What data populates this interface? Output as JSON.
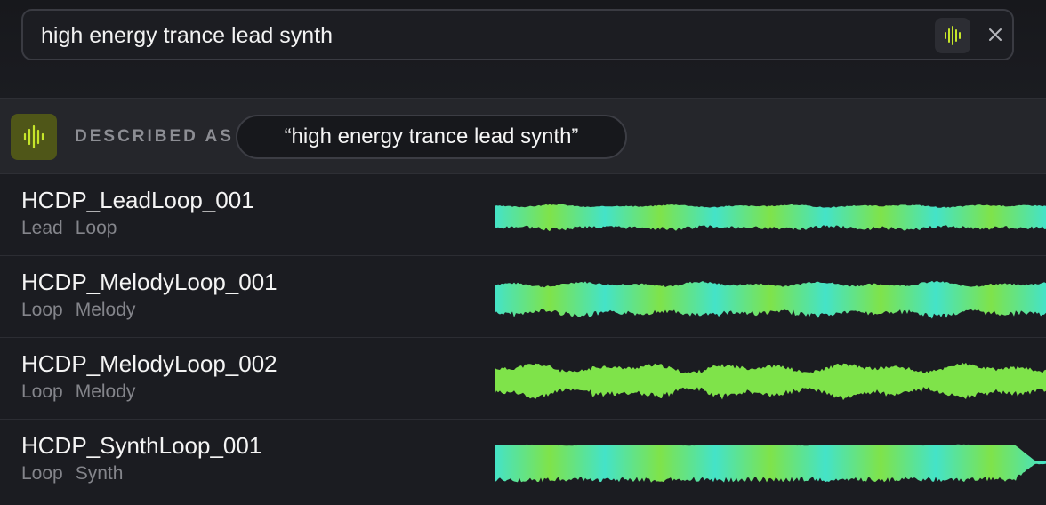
{
  "search": {
    "value": "high energy trance lead synth"
  },
  "description": {
    "label": "DESCRIBED AS",
    "query": "“high energy trance lead synth”"
  },
  "results": [
    {
      "name": "HCDP_LeadLoop_001",
      "tags": [
        "Lead",
        "Loop"
      ]
    },
    {
      "name": "HCDP_MelodyLoop_001",
      "tags": [
        "Loop",
        "Melody"
      ]
    },
    {
      "name": "HCDP_MelodyLoop_002",
      "tags": [
        "Loop",
        "Melody"
      ]
    },
    {
      "name": "HCDP_SynthLoop_001",
      "tags": [
        "Loop",
        "Synth"
      ]
    }
  ],
  "colors": {
    "accent": "#c6e52a",
    "wave_teal": "#44e3c8",
    "wave_green": "#7fe34a"
  },
  "icons": {
    "sonic_search": "waveform-icon",
    "clear": "close-icon"
  }
}
